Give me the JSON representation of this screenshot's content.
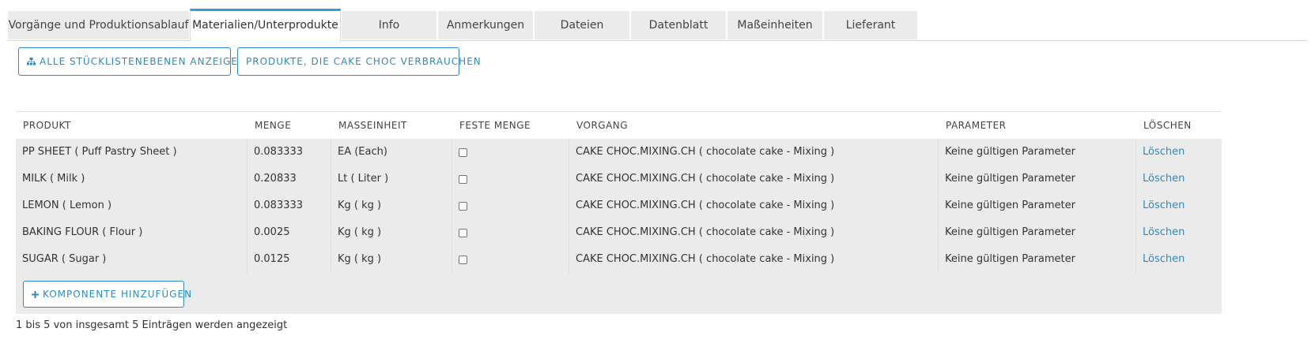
{
  "tabs": [
    {
      "label": "Vorgänge und Produktionsablauf",
      "active": false
    },
    {
      "label": "Materialien/Unterprodukte",
      "active": true
    },
    {
      "label": "Info",
      "active": false
    },
    {
      "label": "Anmerkungen",
      "active": false
    },
    {
      "label": "Dateien",
      "active": false
    },
    {
      "label": "Datenblatt",
      "active": false
    },
    {
      "label": "Maßeinheiten",
      "active": false
    },
    {
      "label": "Lieferant",
      "active": false
    }
  ],
  "actions": {
    "show_bom_levels": "ALLE STÜCKLISTENEBENEN ANZEIGEN",
    "products_consuming": "PRODUKTE, DIE CAKE CHOC VERBRAUCHEN",
    "add_component": "KOMPONENTE HINZUFÜGEN"
  },
  "table": {
    "headers": [
      "PRODUKT",
      "MENGE",
      "MASSEINHEIT",
      "FESTE MENGE",
      "VORGANG",
      "PARAMETER",
      "LÖSCHEN"
    ],
    "rows": [
      {
        "product": "PP SHEET ( Puff Pastry Sheet )",
        "qty": "0.083333",
        "unit": "EA (Each)",
        "fixed": false,
        "operation": "CAKE CHOC.MIXING.CH ( chocolate cake - Mixing )",
        "parameter": "Keine gültigen Parameter",
        "delete": "Löschen"
      },
      {
        "product": "MILK ( Milk )",
        "qty": "0.20833",
        "unit": "Lt ( Liter )",
        "fixed": false,
        "operation": "CAKE CHOC.MIXING.CH ( chocolate cake - Mixing )",
        "parameter": "Keine gültigen Parameter",
        "delete": "Löschen"
      },
      {
        "product": "LEMON ( Lemon )",
        "qty": "0.083333",
        "unit": "Kg ( kg )",
        "fixed": false,
        "operation": "CAKE CHOC.MIXING.CH ( chocolate cake - Mixing )",
        "parameter": "Keine gültigen Parameter",
        "delete": "Löschen"
      },
      {
        "product": "BAKING FLOUR ( Flour )",
        "qty": "0.0025",
        "unit": "Kg ( kg )",
        "fixed": false,
        "operation": "CAKE CHOC.MIXING.CH ( chocolate cake - Mixing )",
        "parameter": "Keine gültigen Parameter",
        "delete": "Löschen"
      },
      {
        "product": "SUGAR ( Sugar )",
        "qty": "0.0125",
        "unit": "Kg ( kg )",
        "fixed": false,
        "operation": "CAKE CHOC.MIXING.CH ( chocolate cake - Mixing )",
        "parameter": "Keine gültigen Parameter",
        "delete": "Löschen"
      }
    ]
  },
  "footer": {
    "info": "1 bis 5 von insgesamt 5 Einträgen werden angezeigt"
  },
  "colors": {
    "accent": "#2e8bc0",
    "tab_active_border": "#2e9fd6",
    "tab_bg": "#ebebeb",
    "table_body_bg": "#ebebeb"
  },
  "icons": {
    "bom_button": "sitemap-icon",
    "add_button": "plus-icon"
  }
}
